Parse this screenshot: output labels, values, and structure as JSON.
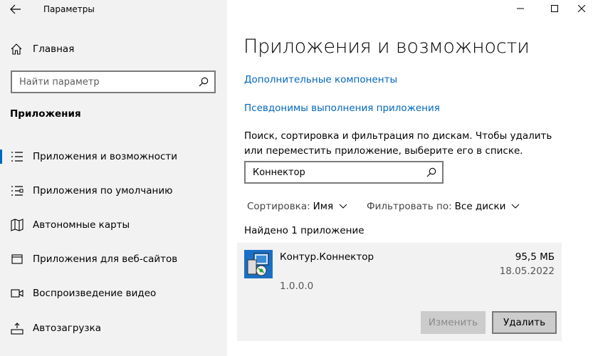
{
  "window": {
    "title": "Параметры",
    "controls": [
      "minimize",
      "maximize",
      "close"
    ]
  },
  "sidebar": {
    "home_label": "Главная",
    "search_placeholder": "Найти параметр",
    "section_title": "Приложения",
    "items": [
      {
        "label": "Приложения и возможности",
        "icon": "apps-features-icon",
        "active": true
      },
      {
        "label": "Приложения по умолчанию",
        "icon": "default-apps-icon",
        "active": false
      },
      {
        "label": "Автономные карты",
        "icon": "offline-maps-icon",
        "active": false
      },
      {
        "label": "Приложения для веб-сайтов",
        "icon": "apps-websites-icon",
        "active": false
      },
      {
        "label": "Воспроизведение видео",
        "icon": "video-playback-icon",
        "active": false
      },
      {
        "label": "Автозагрузка",
        "icon": "startup-icon",
        "active": false
      }
    ]
  },
  "main": {
    "title": "Приложения и возможности",
    "links": {
      "optional_features": "Дополнительные компоненты",
      "execution_aliases": "Псевдонимы выполнения приложения"
    },
    "description": "Поиск, сортировка и фильтрация по дискам. Чтобы удалить или переместить приложение, выберите его в списке.",
    "filter_value": "Коннектор",
    "sort": {
      "label": "Сортировка:",
      "value": "Имя"
    },
    "filter": {
      "label": "Фильтровать по:",
      "value": "Все диски"
    },
    "found_text": "Найдено 1 приложение",
    "app": {
      "name": "Контур.Коннектор",
      "size": "95,5 МБ",
      "date": "18.05.2022",
      "version": "1.0.0.0",
      "modify_label": "Изменить",
      "uninstall_label": "Удалить"
    }
  },
  "colors": {
    "accent": "#0067c0",
    "sidebar_bg": "#f2f2f2",
    "card_bg": "#f2f2f2",
    "button_bg": "#cccccc"
  }
}
